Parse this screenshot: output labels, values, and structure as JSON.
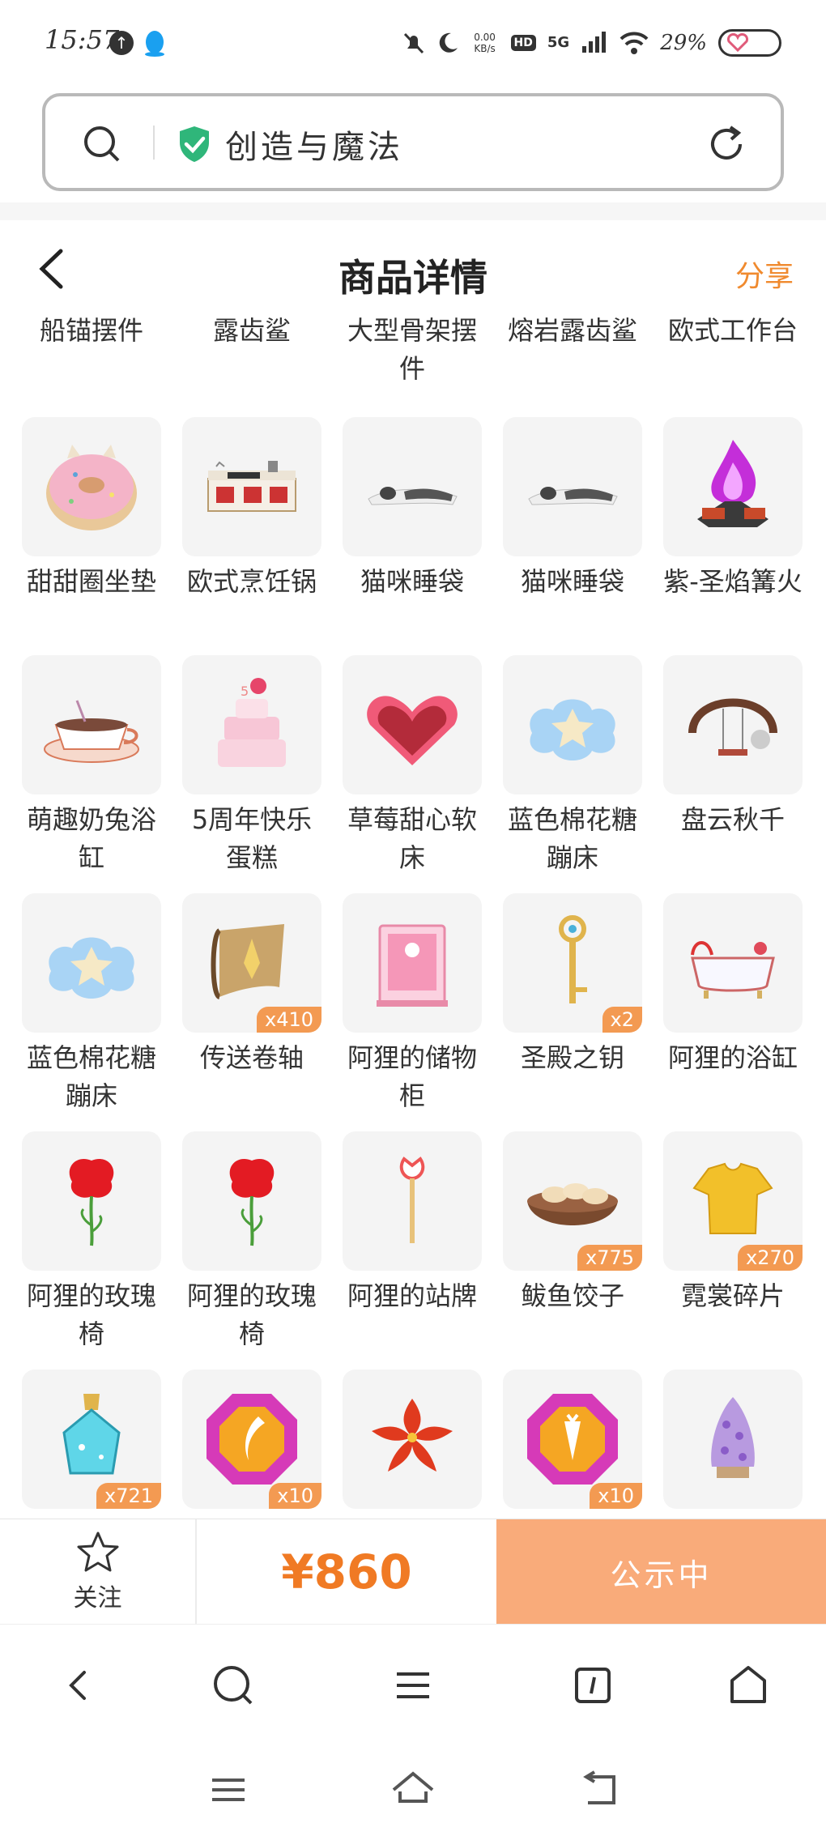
{
  "status_bar": {
    "time": "15:57",
    "net_speed": "0.00",
    "net_unit": "KB/s",
    "hd": "HD",
    "network": "5G",
    "battery": "29%"
  },
  "address_bar": {
    "title": "创造与魔法"
  },
  "page_header": {
    "title": "商品详情",
    "share": "分享"
  },
  "partial_row": [
    "船锚摆件",
    "露齿鲨",
    "大型骨架摆件",
    "熔岩露齿鲨",
    "欧式工作台"
  ],
  "items": [
    {
      "label": "甜甜圈坐垫",
      "icon": "donut-cushion-icon",
      "qty": ""
    },
    {
      "label": "欧式烹饪锅",
      "icon": "stove-icon",
      "qty": ""
    },
    {
      "label": "猫咪睡袋",
      "icon": "cat-sleeping-bag-icon",
      "qty": ""
    },
    {
      "label": "猫咪睡袋",
      "icon": "cat-sleeping-bag-icon",
      "qty": ""
    },
    {
      "label": "紫-圣焰篝火",
      "icon": "purple-bonfire-icon",
      "qty": ""
    },
    {
      "label": "萌趣奶兔浴缸",
      "icon": "teacup-bath-icon",
      "qty": ""
    },
    {
      "label": "5周年快乐蛋糕",
      "icon": "cake-icon",
      "qty": ""
    },
    {
      "label": "草莓甜心软床",
      "icon": "heart-bed-icon",
      "qty": ""
    },
    {
      "label": "蓝色棉花糖蹦床",
      "icon": "cloud-trampoline-icon",
      "qty": ""
    },
    {
      "label": "盘云秋千",
      "icon": "swing-icon",
      "qty": ""
    },
    {
      "label": "蓝色棉花糖蹦床",
      "icon": "cloud-trampoline-icon",
      "qty": ""
    },
    {
      "label": "传送卷轴",
      "icon": "scroll-icon",
      "qty": "x410"
    },
    {
      "label": "阿狸的储物柜",
      "icon": "pink-cabinet-icon",
      "qty": ""
    },
    {
      "label": "圣殿之钥",
      "icon": "golden-key-icon",
      "qty": "x2"
    },
    {
      "label": "阿狸的浴缸",
      "icon": "bathtub-icon",
      "qty": ""
    },
    {
      "label": "阿狸的玫瑰椅",
      "icon": "rose-chair-icon",
      "qty": ""
    },
    {
      "label": "阿狸的玫瑰椅",
      "icon": "rose-chair-icon",
      "qty": ""
    },
    {
      "label": "阿狸的站牌",
      "icon": "signpost-icon",
      "qty": ""
    },
    {
      "label": "鲅鱼饺子",
      "icon": "dumplings-icon",
      "qty": "x775"
    },
    {
      "label": "霓裳碎片",
      "icon": "shirt-fragment-icon",
      "qty": "x270"
    },
    {
      "label": "",
      "icon": "potion-bottle-icon",
      "qty": "x721"
    },
    {
      "label": "",
      "icon": "pink-gem-icon",
      "qty": "x10"
    },
    {
      "label": "",
      "icon": "red-flower-icon",
      "qty": ""
    },
    {
      "label": "",
      "icon": "gem-carrot-icon",
      "qty": "x10"
    },
    {
      "label": "",
      "icon": "purple-tree-icon",
      "qty": ""
    }
  ],
  "action_bar": {
    "follow": "关注",
    "price": "¥860",
    "status": "公示中"
  }
}
